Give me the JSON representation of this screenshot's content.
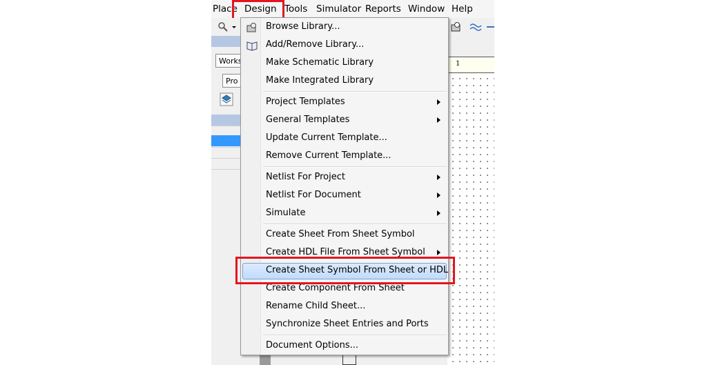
{
  "menubar": {
    "items": [
      "Place",
      "Design",
      "Tools",
      "Simulator",
      "Reports",
      "Window",
      "Help"
    ]
  },
  "workspace": {
    "workspace_btn": "Works",
    "project_btn": "Pro",
    "ruler_label": "1"
  },
  "design_menu": {
    "items": [
      {
        "label": "Browse Library...",
        "icon": "browse-library-icon",
        "submenu": false
      },
      {
        "label": "Add/Remove Library...",
        "icon": "book-icon",
        "submenu": false
      },
      {
        "label": "Make Schematic Library",
        "submenu": false
      },
      {
        "label": "Make Integrated Library",
        "submenu": false
      },
      {
        "label": "Project Templates",
        "submenu": true
      },
      {
        "label": "General Templates",
        "submenu": true
      },
      {
        "label": "Update Current Template...",
        "submenu": false
      },
      {
        "label": "Remove Current Template...",
        "submenu": false
      },
      {
        "label": "Netlist For Project",
        "submenu": true
      },
      {
        "label": "Netlist For Document",
        "submenu": true
      },
      {
        "label": "Simulate",
        "submenu": true
      },
      {
        "label": "Create Sheet From Sheet Symbol",
        "submenu": false
      },
      {
        "label": "Create HDL File From Sheet Symbol",
        "submenu": true
      },
      {
        "label": "Create Sheet Symbol From Sheet or HDL",
        "submenu": false,
        "highlighted": true
      },
      {
        "label": "Create Component From Sheet",
        "submenu": false
      },
      {
        "label": "Rename Child Sheet...",
        "submenu": false
      },
      {
        "label": "Synchronize Sheet Entries and Ports",
        "submenu": false
      },
      {
        "label": "Document Options...",
        "submenu": false
      }
    ]
  },
  "colors": {
    "callout": "#e3151f",
    "highlight": "#c1dbfc",
    "selection": "#3399ff"
  }
}
